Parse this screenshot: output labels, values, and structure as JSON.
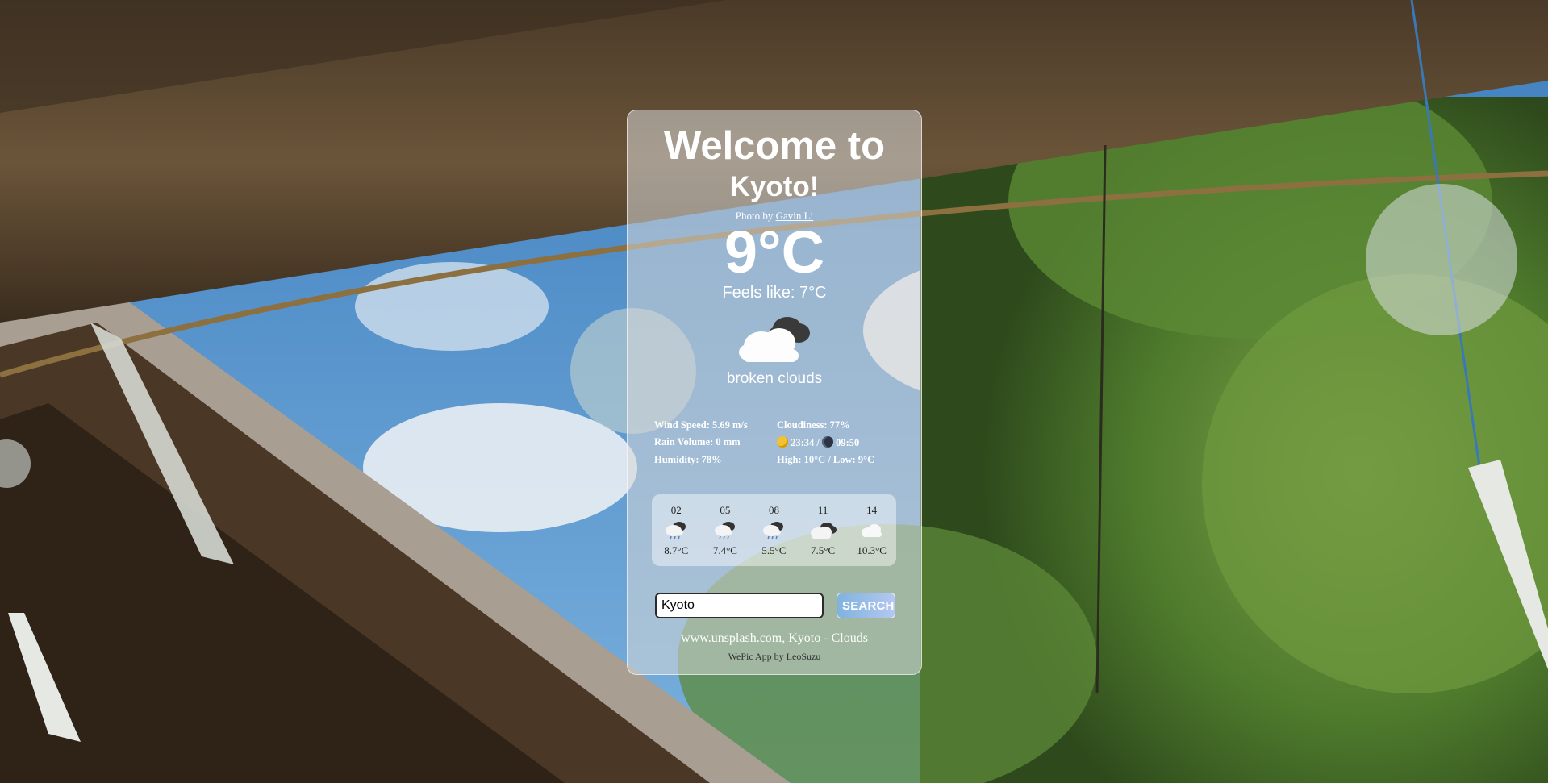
{
  "header": {
    "welcome": "Welcome to",
    "city_line": "Kyoto!"
  },
  "photo_credit": {
    "prefix": "Photo by",
    "author": "Gavin Li"
  },
  "current": {
    "temperature": "9°C",
    "feels_like": "Feels like: 7°C",
    "icon": "broken-clouds-icon",
    "description": "broken clouds"
  },
  "details": {
    "wind": "Wind Speed: 5.69 m/s",
    "cloudiness": "Cloudiness: 77%",
    "rain": "Rain Volume: 0 mm",
    "sun_times": "23:34 / ",
    "moon_time": "09:50",
    "humidity": "Humidity: 78%",
    "high_low": "High: 10°C / Low: 9°C"
  },
  "forecast": [
    {
      "hour": "02",
      "icon": "rain-cloud-icon",
      "temp": "8.7°C"
    },
    {
      "hour": "05",
      "icon": "rain-cloud-icon",
      "temp": "7.4°C"
    },
    {
      "hour": "08",
      "icon": "rain-cloud-icon",
      "temp": "5.5°C"
    },
    {
      "hour": "11",
      "icon": "broken-clouds-icon",
      "temp": "7.5°C"
    },
    {
      "hour": "14",
      "icon": "cloud-icon",
      "temp": "10.3°C"
    }
  ],
  "search": {
    "value": "Kyoto",
    "button_label": "SEARCH"
  },
  "footer": {
    "source": "www.unsplash.com, Kyoto - Clouds",
    "app_by": "WePic App by LeoSuzu"
  }
}
